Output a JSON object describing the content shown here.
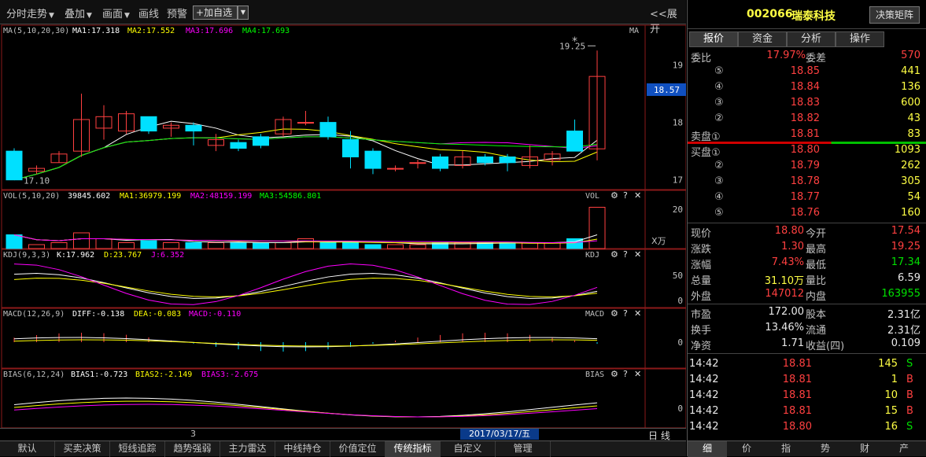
{
  "toolbar": {
    "items": [
      "分时走势",
      "叠加",
      "画面",
      "画线",
      "预警"
    ],
    "add_watch": "加自选",
    "expand": "<<展开"
  },
  "main_panel": {
    "ma_label": "MA(5,10,20,30)",
    "ma1": "MA1:17.318",
    "ma2": "MA2:17.552",
    "ma3": "MA3:17.696",
    "ma4": "MA4:17.693",
    "ma_tag": "MA",
    "high_mark": "19.25",
    "low_mark": "17.10",
    "star": "*",
    "current_price_tag": "18.57",
    "y_ticks": [
      "19",
      "18",
      "17"
    ]
  },
  "vol_panel": {
    "label": "VOL(5,10,20)",
    "value": "39845.602",
    "ma1": "MA1:36979.199",
    "ma2": "MA2:48159.199",
    "ma3": "MA3:54586.801",
    "tag": "VOL",
    "y_tick": "20",
    "unit": "X万"
  },
  "kdj_panel": {
    "label": "KDJ(9,3,3)",
    "k": "K:17.962",
    "d": "D:23.767",
    "j": "J:6.352",
    "tag": "KDJ",
    "y_ticks": [
      "50",
      "0"
    ]
  },
  "macd_panel": {
    "label": "MACD(12,26,9)",
    "diff": "DIFF:-0.138",
    "dea": "DEA:-0.083",
    "macd": "MACD:-0.110",
    "tag": "MACD",
    "y_tick": "0"
  },
  "bias_panel": {
    "label": "BIAS(6,12,24)",
    "b1": "BIAS1:-0.723",
    "b2": "BIAS2:-2.149",
    "b3": "BIAS3:-2.675",
    "tag": "BIAS",
    "y_tick": "0"
  },
  "date_bar": {
    "period": "3",
    "date": "2017/03/17/五",
    "day": "日 线"
  },
  "bottom_tabs": [
    "默认",
    "买卖决策",
    "短线追踪",
    "趋势强弱",
    "主力雷达",
    "中线持仓",
    "价值定位",
    "传统指标",
    "自定义",
    "管理"
  ],
  "active_tab": "传统指标",
  "stock": {
    "code": "002066",
    "name": "瑞泰科技",
    "decision": "决策矩阵"
  },
  "right_tabs": [
    "报价",
    "资金",
    "分析",
    "操作"
  ],
  "quote": {
    "wei_bi_label": "委比",
    "wei_bi": "17.97%",
    "wei_cha_label": "委差",
    "wei_cha": "570",
    "sell": [
      {
        "label": "⑤",
        "price": "18.85",
        "vol": "441"
      },
      {
        "label": "④",
        "price": "18.84",
        "vol": "136"
      },
      {
        "label": "③",
        "price": "18.83",
        "vol": "600"
      },
      {
        "label": "②",
        "price": "18.82",
        "vol": "43"
      },
      {
        "label": "卖盘①",
        "price": "18.81",
        "vol": "83"
      }
    ],
    "buy": [
      {
        "label": "买盘①",
        "price": "18.80",
        "vol": "1093"
      },
      {
        "label": "②",
        "price": "18.79",
        "vol": "262"
      },
      {
        "label": "③",
        "price": "18.78",
        "vol": "305"
      },
      {
        "label": "④",
        "price": "18.77",
        "vol": "54"
      },
      {
        "label": "⑤",
        "price": "18.76",
        "vol": "160"
      }
    ],
    "stats": [
      {
        "l1": "现价",
        "v1": "18.80",
        "c1": "red",
        "l2": "今开",
        "v2": "17.54",
        "c2": "red"
      },
      {
        "l1": "涨跌",
        "v1": "1.30",
        "c1": "red",
        "l2": "最高",
        "v2": "19.25",
        "c2": "red"
      },
      {
        "l1": "涨幅",
        "v1": "7.43%",
        "c1": "red",
        "l2": "最低",
        "v2": "17.34",
        "c2": "green"
      },
      {
        "l1": "总量",
        "v1": "31.10万",
        "c1": "yellow",
        "l2": "量比",
        "v2": "6.59",
        "c2": "white"
      },
      {
        "l1": "外盘",
        "v1": "147012",
        "c1": "red",
        "l2": "内盘",
        "v2": "163955",
        "c2": "green"
      }
    ],
    "fund": [
      {
        "l1": "市盈",
        "v1": "172.00",
        "l2": "股本",
        "v2": "2.31亿"
      },
      {
        "l1": "换手",
        "v1": "13.46%",
        "l2": "流通",
        "v2": "2.31亿"
      },
      {
        "l1": "净资",
        "v1": "1.71",
        "l2": "收益(四)",
        "v2": "0.109"
      }
    ],
    "ticks": [
      {
        "time": "14:42",
        "price": "18.81",
        "vol": "145",
        "side": "S",
        "sc": "green"
      },
      {
        "time": "14:42",
        "price": "18.81",
        "vol": "1",
        "side": "B",
        "sc": "red"
      },
      {
        "time": "14:42",
        "price": "18.81",
        "vol": "10",
        "side": "B",
        "sc": "red"
      },
      {
        "time": "14:42",
        "price": "18.81",
        "vol": "15",
        "side": "B",
        "sc": "red"
      },
      {
        "time": "14:42",
        "price": "18.80",
        "vol": "16",
        "side": "S",
        "sc": "green"
      }
    ]
  },
  "right_bottom_tabs": [
    "细",
    "价",
    "指",
    "势",
    "财",
    "产"
  ],
  "right_bottom_active": "细",
  "colors": {
    "up": "#ff4040",
    "down": "#00e0ff",
    "ma1": "#ffffff",
    "ma2": "#ffff00",
    "ma3": "#ff00ff",
    "ma4": "#00ff00"
  },
  "chart_data": {
    "type": "candlestick",
    "ohlc": [
      [
        17.5,
        17.55,
        17.0,
        17.0
      ],
      [
        17.15,
        17.25,
        17.1,
        17.2
      ],
      [
        17.3,
        17.5,
        17.3,
        17.45
      ],
      [
        17.5,
        18.5,
        17.4,
        18.05
      ],
      [
        17.9,
        18.3,
        17.7,
        18.1
      ],
      [
        17.85,
        18.2,
        17.8,
        18.15
      ],
      [
        18.1,
        18.0,
        17.8,
        17.85
      ],
      [
        17.9,
        18.0,
        17.75,
        17.95
      ],
      [
        17.95,
        18.0,
        17.6,
        17.85
      ],
      [
        17.6,
        17.8,
        17.5,
        17.7
      ],
      [
        17.65,
        17.7,
        17.5,
        17.55
      ],
      [
        17.75,
        17.8,
        17.55,
        17.6
      ],
      [
        17.8,
        18.1,
        17.75,
        18.05
      ],
      [
        18.0,
        18.2,
        17.95,
        18.0
      ],
      [
        18.0,
        18.1,
        17.7,
        17.75
      ],
      [
        17.7,
        17.85,
        17.2,
        17.4
      ],
      [
        17.5,
        17.55,
        17.1,
        17.2
      ],
      [
        17.2,
        17.25,
        17.15,
        17.2
      ],
      [
        17.3,
        17.35,
        17.2,
        17.3
      ],
      [
        17.4,
        17.45,
        17.15,
        17.2
      ],
      [
        17.25,
        17.5,
        17.2,
        17.4
      ],
      [
        17.4,
        17.45,
        17.25,
        17.3
      ],
      [
        17.4,
        17.45,
        17.15,
        17.3
      ],
      [
        17.25,
        17.6,
        17.2,
        17.4
      ],
      [
        17.35,
        17.5,
        17.25,
        17.45
      ],
      [
        17.85,
        18.05,
        17.5,
        17.5
      ],
      [
        17.54,
        19.25,
        17.34,
        18.8
      ]
    ],
    "y_range": [
      16.9,
      19.5
    ],
    "volume": [
      7,
      2,
      3,
      8,
      5,
      3,
      4,
      3,
      3,
      3,
      3,
      3,
      3,
      5,
      3,
      3,
      2,
      2,
      2,
      3,
      3,
      3,
      3,
      3,
      3,
      5,
      21
    ],
    "vol_range": [
      0,
      24
    ]
  }
}
